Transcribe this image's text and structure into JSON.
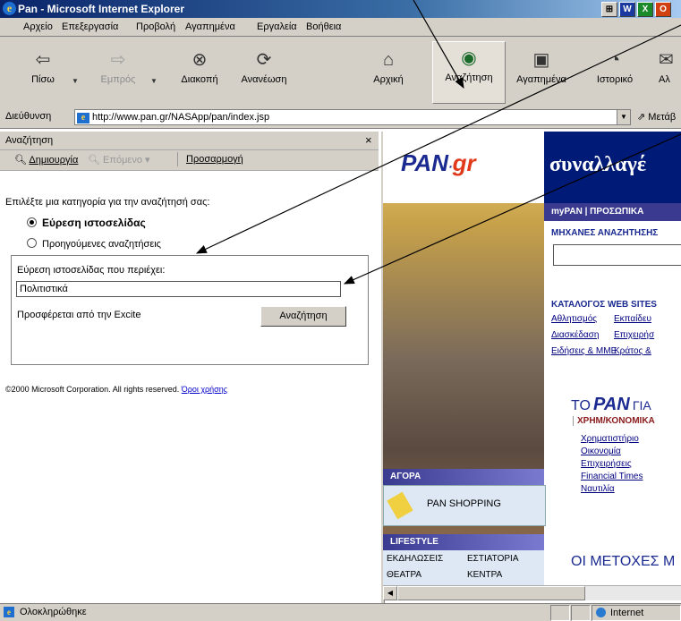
{
  "window": {
    "title": "Pan - Microsoft Internet Explorer"
  },
  "menu": [
    "Αρχείο",
    "Επεξεργασία",
    "Προβολή",
    "Αγαπημένα",
    "Εργαλεία",
    "Βοήθεια"
  ],
  "toolbar": {
    "back": "Πίσω",
    "forward": "Εμπρός",
    "stop": "Διακοπή",
    "refresh": "Ανανέωση",
    "home": "Αρχική",
    "search": "Αναζήτηση",
    "favorites": "Αγαπημένα",
    "history": "Ιστορικό",
    "more": "Αλ"
  },
  "address": {
    "label": "Διεύθυνση",
    "url": "http://www.pan.gr/NASApp/pan/index.jsp",
    "go": "Μετάβ"
  },
  "search_pane": {
    "title": "Αναζήτηση",
    "new": "Δημιουργία",
    "next": "Επόμενο",
    "customize": "Προσαρμογή",
    "prompt": "Επιλέξτε μια κατηγορία για την αναζήτησή σας:",
    "option_find": "Εύρεση ιστοσελίδας",
    "option_previous": "Προηγούμενες αναζητήσεις",
    "field_label": "Εύρεση ιστοσελίδας που περιέχει:",
    "query": "Πολιτιστικά",
    "provider": "Προσφέρεται από την Excite",
    "button": "Αναζήτηση",
    "copyright": "©2000 Microsoft Corporation. All rights reserved.",
    "terms": "Όροι χρήσης"
  },
  "web": {
    "logo_pan": "PAN",
    "logo_gr": "gr",
    "banner": "συναλλαγέ",
    "nav": "myPAN | ΠΡΟΣΩΠΙΚΑ",
    "engines": "ΜΗΧΑΝΕΣ ΑΝΑΖΗΤΗΣΗΣ",
    "catalog": "ΚΑΤΑΛΟΓΟΣ WEB SITES",
    "cat_links": [
      "Αθλητισμός",
      "Εκπαίδευ",
      "Διασκέδαση",
      "Επιχειρήσ",
      "Ειδήσεις & ΜΜΕ",
      "Κράτος &"
    ],
    "to_pan_a": "ΤΟ",
    "to_pan_b": "PAN",
    "to_pan_c": "ΓΙΑ",
    "finance_head": "ΧΡΗΜ/ΚΟΝΟΜΙΚΑ",
    "finance_links": [
      "Χρηματιστήριο",
      "Οικονομία",
      "Επιχειρήσεις",
      "Financial Times",
      "Ναυτιλία"
    ],
    "market": "ΑΓΟΡΑ",
    "shopping": "PAN SHOPPING",
    "lifestyle": "LIFESTYLE",
    "life_links": [
      "ΕΚΔΗΛΩΣΕΙΣ",
      "ΕΣΤΙΑΤΟΡΙΑ",
      "ΘΕΑΤΡΑ",
      "ΚΕΝΤΡΑ"
    ],
    "shares": "ΟΙ ΜΕΤΟΧΕΣ Μ"
  },
  "status": {
    "text": "Ολοκληρώθηκε",
    "zone": "Internet"
  }
}
